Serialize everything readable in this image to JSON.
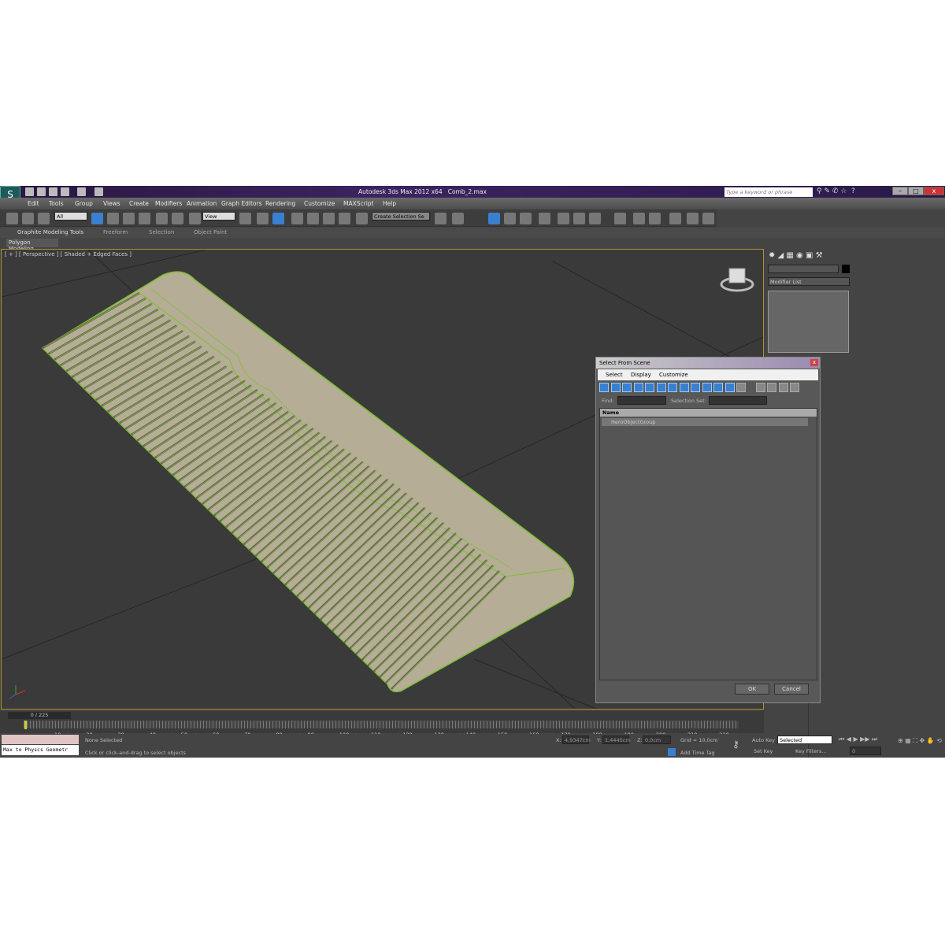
{
  "app": {
    "title": "Autodesk 3ds Max  2012 x64",
    "file": "Comb_2.max",
    "search_placeholder": "Type a keyword or phrase"
  },
  "menu": [
    "Edit",
    "Tools",
    "Group",
    "Views",
    "Create",
    "Modifiers",
    "Animation",
    "Graph Editors",
    "Rendering",
    "Customize",
    "MAXScript",
    "Help"
  ],
  "toolbar": {
    "filter": "All",
    "ref_coord": "View",
    "selection_set": "Create Selection Se"
  },
  "ribbon": {
    "tabs": [
      "Graphite Modeling Tools",
      "Freeform",
      "Selection",
      "Object Paint"
    ],
    "panel": "Polygon Modeling"
  },
  "viewport": {
    "label": "[ + ] [ Perspective ] [ Shaded + Edged Faces ]",
    "wire_color": "#7ac030",
    "mesh_color": "#b5ad95"
  },
  "command_panel": {
    "modifier_list": "Modifier List"
  },
  "dialog": {
    "title": "Select From Scene",
    "menu": [
      "Select",
      "Display",
      "Customize"
    ],
    "find_label": "Find:",
    "find_value": "",
    "selset_label": "Selection Set:",
    "column": "Name",
    "rows": [
      "HeroObjectGroup"
    ],
    "ok": "OK",
    "cancel": "Cancel"
  },
  "timeline": {
    "position": "0 / 225",
    "ticks": [
      "10",
      "20",
      "30",
      "40",
      "50",
      "60",
      "70",
      "80",
      "90",
      "100",
      "110",
      "120",
      "130",
      "140",
      "150",
      "160",
      "170",
      "180",
      "190",
      "200",
      "210",
      "220"
    ]
  },
  "status": {
    "script": "Max to Physcs Geometr",
    "selection": "None Selected",
    "prompt": "Click or click-and-drag to select objects",
    "x_label": "X:",
    "x": "4,9347cm",
    "y_label": "Y:",
    "y": "1,4445cm",
    "z_label": "Z:",
    "z": "0,0cm",
    "grid": "Grid = 10,0cm",
    "add_time_tag": "Add Time Tag",
    "auto_key": "Auto Key",
    "set_key": "Set Key",
    "key_mode": "Selected",
    "key_filters": "Key Filters...",
    "frame": "0"
  }
}
